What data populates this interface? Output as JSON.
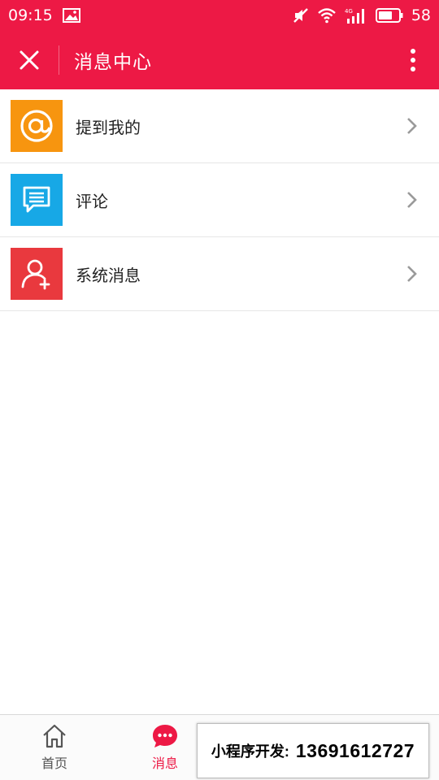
{
  "status_bar": {
    "time": "09:15",
    "battery": "58",
    "network": "4G"
  },
  "header": {
    "title": "消息中心",
    "icons": {
      "close": "close-icon",
      "more": "more-vertical-icon"
    }
  },
  "message_list": {
    "items": [
      {
        "label": "提到我的",
        "icon": "at-icon",
        "color": "#f7950f"
      },
      {
        "label": "评论",
        "icon": "comment-icon",
        "color": "#17a8e6"
      },
      {
        "label": "系统消息",
        "icon": "user-add-icon",
        "color": "#e9393e"
      }
    ]
  },
  "tab_bar": {
    "tabs": [
      {
        "label": "首页",
        "icon": "home-icon",
        "active": false
      },
      {
        "label": "消息",
        "icon": "chat-bubble-icon",
        "active": true
      }
    ],
    "active_color": "#ed1945"
  },
  "promo": {
    "label": "小程序开发:",
    "number": "13691612727"
  },
  "colors": {
    "brand": "#ed1945",
    "divider": "#e6e6e6"
  }
}
